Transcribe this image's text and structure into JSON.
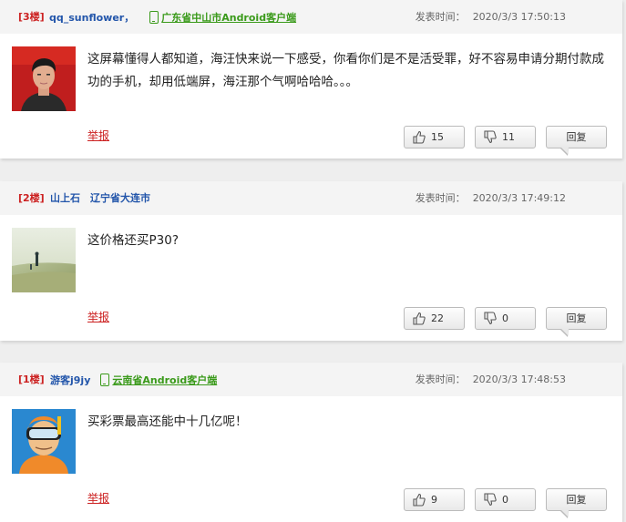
{
  "posts": [
    {
      "floor": "[3楼]",
      "username": "qq_sunflower，",
      "location": "广东省中山市Android客户端",
      "time_label": "发表时间：",
      "time": "2020/3/3 17:50:13",
      "content": "这屏幕懂得人都知道，海汪快来说一下感受，你看你们是不是活受罪，好不容易申请分期付款成功的手机，却用低端屏，海汪那个气啊哈哈哈。。。",
      "report_label": "举报",
      "likes": "15",
      "dislikes": "11",
      "reply_label": "回复",
      "avatar_icon": "avatar-photo-man-red-background"
    },
    {
      "floor": "[2楼]",
      "username": "山上石",
      "location": "辽宁省大连市",
      "time_label": "发表时间：",
      "time": "2020/3/3 17:49:12",
      "content": "这价格还买P30?",
      "report_label": "举报",
      "likes": "22",
      "dislikes": "0",
      "reply_label": "回复",
      "avatar_icon": "avatar-photo-beach-figure"
    },
    {
      "floor": "[1楼]",
      "username": "游客j9jy",
      "location": "云南省Android客户端",
      "time_label": "发表时间：",
      "time": "2020/3/3 17:48:53",
      "content": "买彩票最高还能中十几亿呢！",
      "report_label": "举报",
      "likes": "9",
      "dislikes": "0",
      "reply_label": "回复",
      "avatar_icon": "avatar-cartoon-diver"
    }
  ],
  "colors": {
    "floor": "#cc2222",
    "username": "#2255aa",
    "android_location": "#3a9a1a",
    "header_bg": "#f4f4f4",
    "page_bg": "#eeeeee"
  },
  "icons": {
    "like": "thumbs-up-icon",
    "dislike": "thumbs-down-icon",
    "phone": "phone-icon"
  }
}
